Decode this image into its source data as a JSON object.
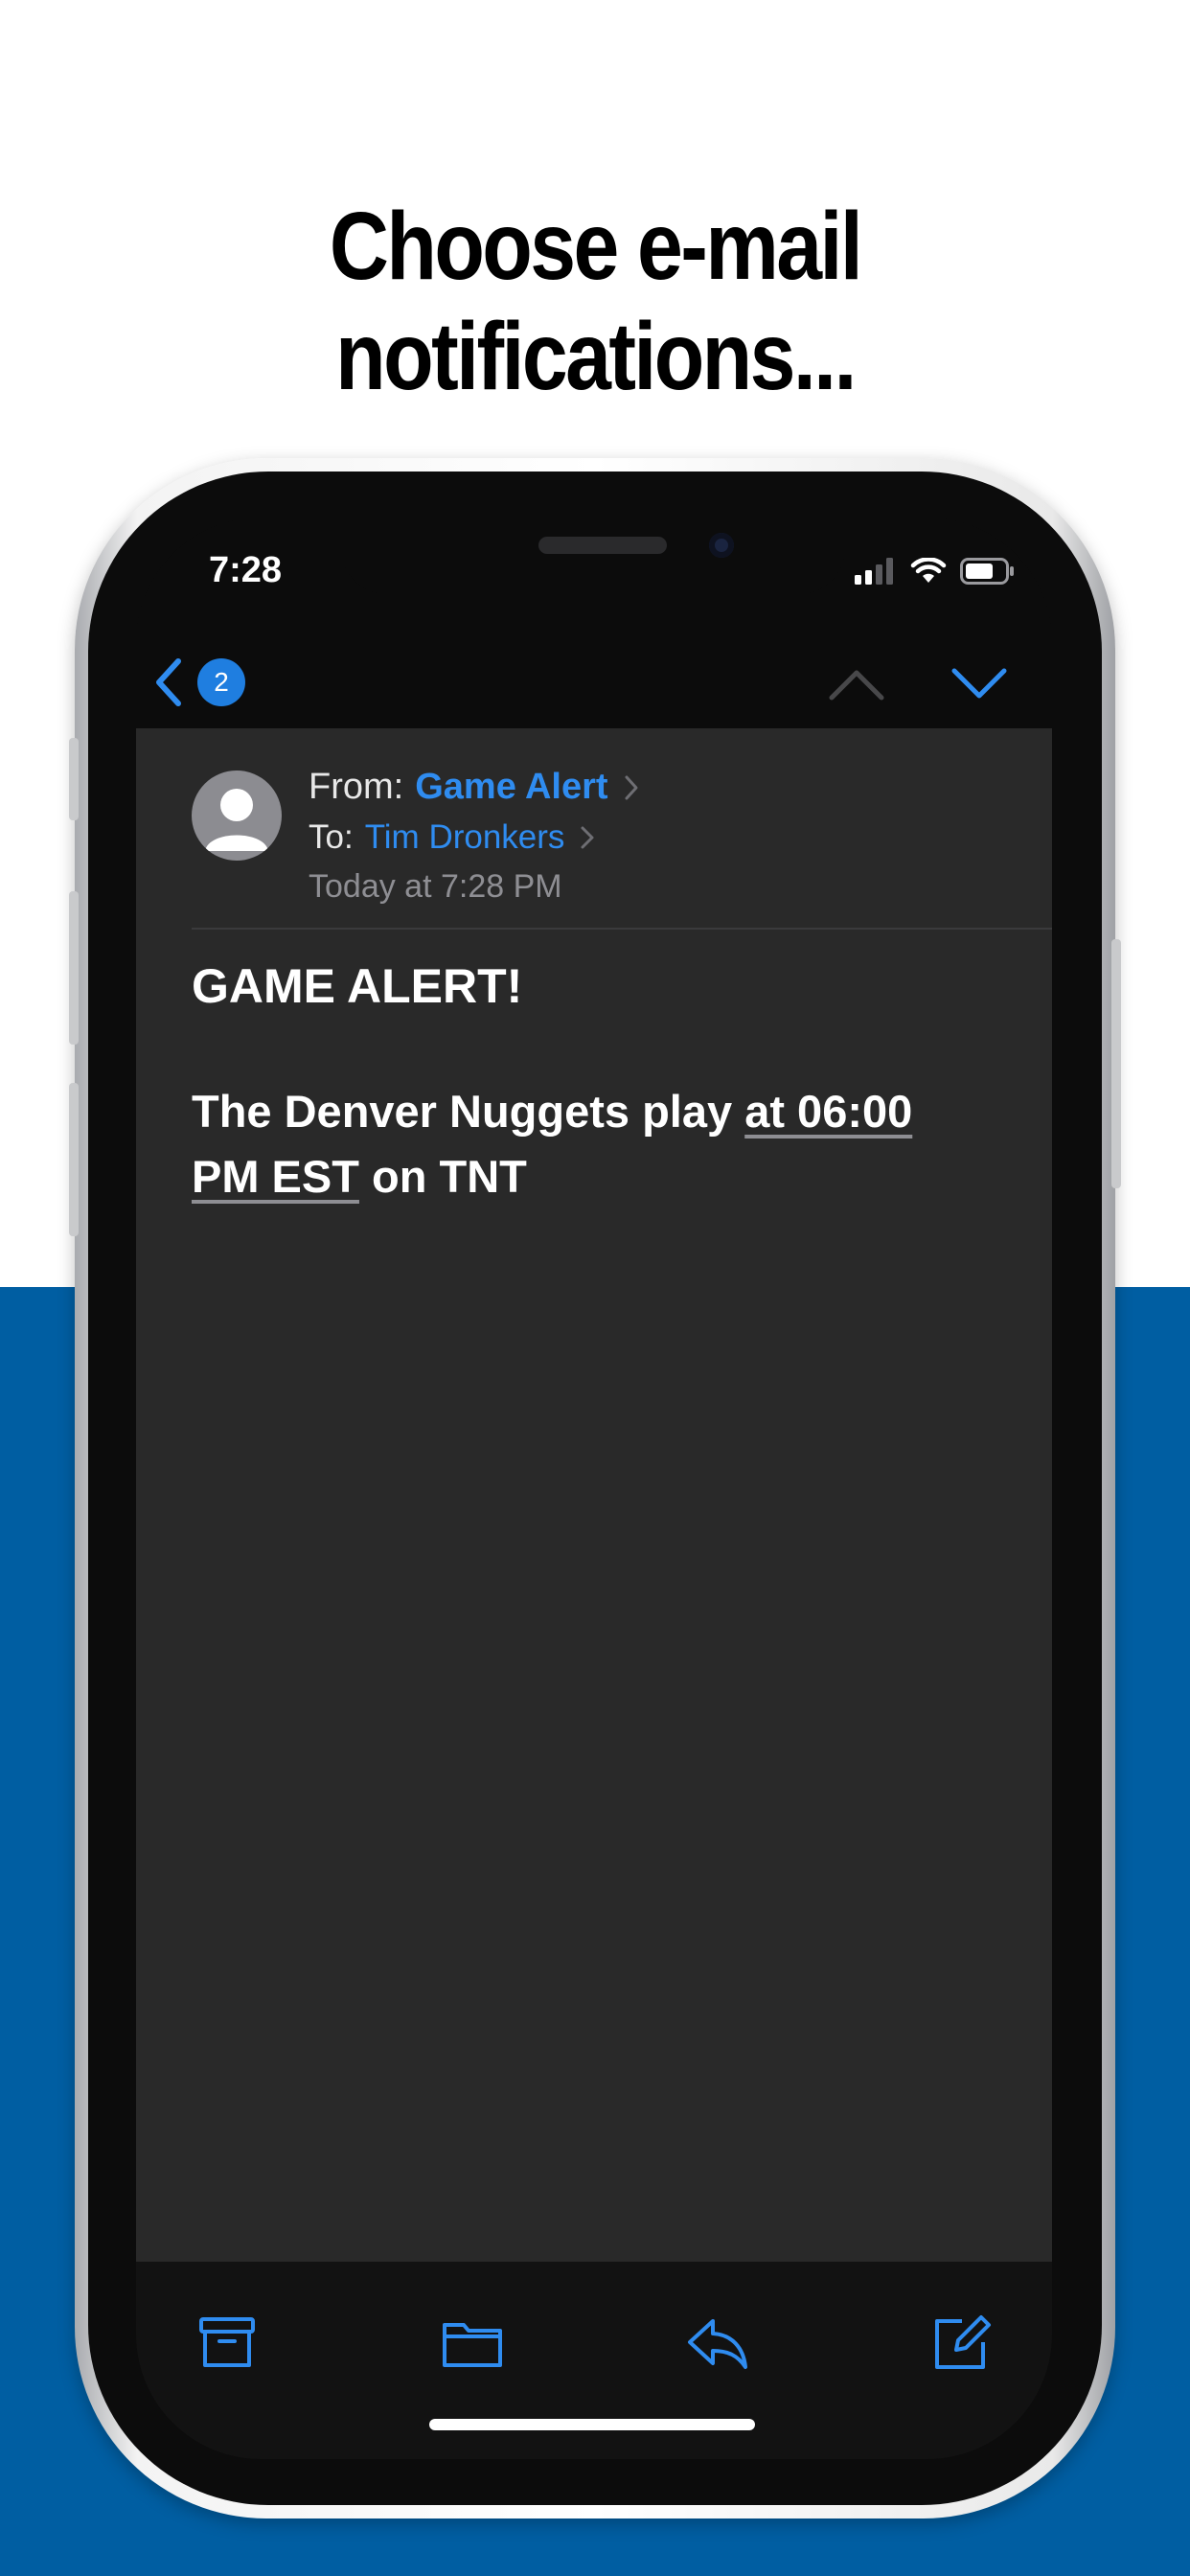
{
  "headline": "Choose e-mail notifications...",
  "status_bar": {
    "time": "7:28"
  },
  "nav": {
    "unread_count": "2"
  },
  "mail": {
    "from_label": "From:",
    "from_name": "Game Alert",
    "to_label": "To:",
    "to_name": "Tim Dronkers",
    "date": "Today at 7:28 PM",
    "subject": "GAME ALERT!",
    "message_start": "The Denver Nuggets play ",
    "message_link_1": "at 06:00",
    "message_link_2": "PM EST",
    "message_end": " on TNT"
  },
  "icons": {
    "toolbar": [
      "archive-icon",
      "folder-icon",
      "reply-icon",
      "compose-icon"
    ],
    "nav": [
      "chevron-left-icon",
      "chevron-up-icon",
      "chevron-down-icon"
    ]
  },
  "colors": {
    "accent": "#2f8cf0",
    "band_blue": "#005ea2",
    "mail_background": "#292929"
  }
}
